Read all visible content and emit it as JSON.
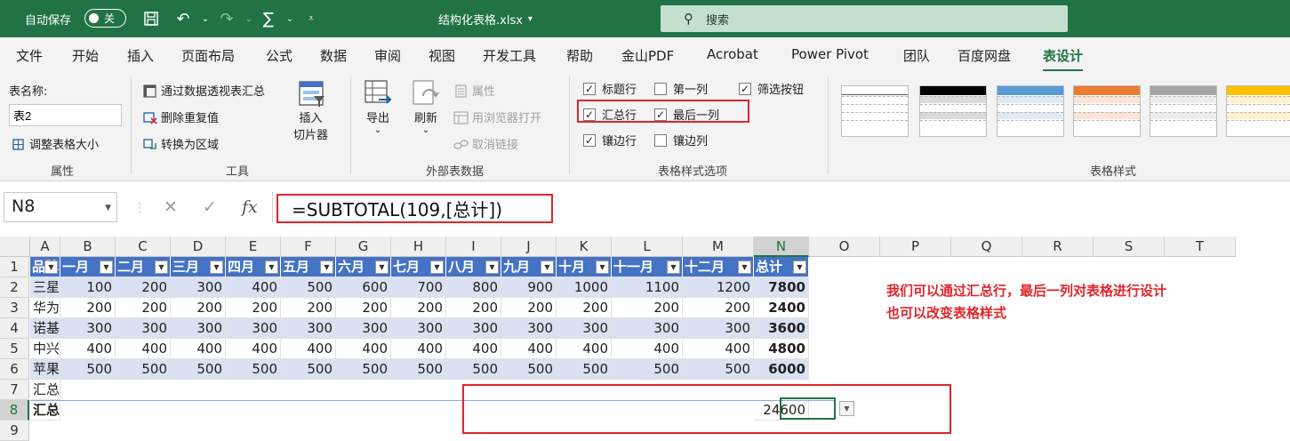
{
  "titlebar": {
    "autosave_label": "自动保存",
    "autosave_state": "关",
    "filename": "结构化表格.xlsx",
    "filename_caret": "▾",
    "search_placeholder": "搜索"
  },
  "menu": {
    "tabs": [
      "文件",
      "开始",
      "插入",
      "页面布局",
      "公式",
      "数据",
      "审阅",
      "视图",
      "开发工具",
      "帮助",
      "金山PDF",
      "Acrobat",
      "Power Pivot",
      "团队",
      "百度网盘",
      "表设计"
    ],
    "active": "表设计"
  },
  "ribbon": {
    "properties": {
      "table_name_label": "表名称:",
      "table_name_value": "表2",
      "resize_label": "调整表格大小",
      "group": "属性"
    },
    "tools": {
      "pivot_label": "通过数据透视表汇总",
      "remove_dup_label": "删除重复值",
      "convert_label": "转换为区域",
      "slicer_line1": "插入",
      "slicer_line2": "切片器",
      "group": "工具"
    },
    "external": {
      "export_label": "导出",
      "refresh_label": "刷新",
      "properties_label": "属性",
      "browser_label": "用浏览器打开",
      "unlink_label": "取消链接",
      "group": "外部表数据"
    },
    "style_options": {
      "header_row": "标题行",
      "first_col": "第一列",
      "filter_btn": "筛选按钮",
      "total_row": "汇总行",
      "last_col": "最后一列",
      "banded_rows": "镶边行",
      "banded_cols": "镶边列",
      "group": "表格样式选项"
    },
    "styles": {
      "group": "表格样式",
      "colors": [
        "#5a5a5a",
        "#000000",
        "#5b9bd5",
        "#ed7d31",
        "#a5a5a5",
        "#ffc000"
      ]
    }
  },
  "formula_bar": {
    "name_box": "N8",
    "formula": "=SUBTOTAL(109,[总计])"
  },
  "sheet": {
    "columns": [
      "A",
      "B",
      "C",
      "D",
      "E",
      "F",
      "G",
      "H",
      "I",
      "J",
      "K",
      "L",
      "M",
      "N",
      "O",
      "P",
      "Q",
      "R",
      "S",
      "T"
    ],
    "rows": [
      "1",
      "2",
      "3",
      "4",
      "5",
      "6",
      "7",
      "8",
      "9"
    ],
    "header": [
      "品牌",
      "一月",
      "二月",
      "三月",
      "四月",
      "五月",
      "六月",
      "七月",
      "八月",
      "九月",
      "十月",
      "十一月",
      "十二月",
      "总计"
    ],
    "data": [
      [
        "三星",
        "100",
        "200",
        "300",
        "400",
        "500",
        "600",
        "700",
        "800",
        "900",
        "1000",
        "1100",
        "1200",
        "7800"
      ],
      [
        "华为",
        "200",
        "200",
        "200",
        "200",
        "200",
        "200",
        "200",
        "200",
        "200",
        "200",
        "200",
        "200",
        "2400"
      ],
      [
        "诺基亚",
        "300",
        "300",
        "300",
        "300",
        "300",
        "300",
        "300",
        "300",
        "300",
        "300",
        "300",
        "300",
        "3600"
      ],
      [
        "中兴",
        "400",
        "400",
        "400",
        "400",
        "400",
        "400",
        "400",
        "400",
        "400",
        "400",
        "400",
        "400",
        "4800"
      ],
      [
        "苹果",
        "500",
        "500",
        "500",
        "500",
        "500",
        "500",
        "500",
        "500",
        "500",
        "500",
        "500",
        "500",
        "6000"
      ]
    ],
    "row7_label": "汇总",
    "row8_label": "汇总",
    "total_value": "24600",
    "annotation_line1": "我们可以通过汇总行，最后一列对表格进行设计",
    "annotation_line2": "也可以改变表格样式"
  }
}
